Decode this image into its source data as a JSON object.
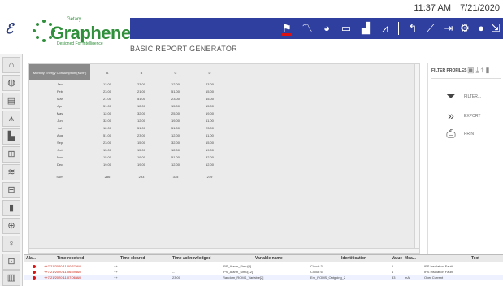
{
  "header": {
    "time": "11:37 AM",
    "date": "7/21/2020",
    "logo_mark": "ℰ",
    "brand": "Graphene",
    "brand_trademark": "®",
    "brand_company": "Getary",
    "brand_tagline": "Designed For Intelligence"
  },
  "page_title": "BASIC REPORT GENERATOR",
  "navbar_icons": [
    "alarm-flag-icon",
    "line-chart-icon",
    "pie-chart-icon",
    "monitor-icon",
    "bar-chart-icon",
    "report-chart-icon",
    "back-arrow-icon",
    "trend-icon",
    "export-icon",
    "settings-gear-icon",
    "user-icon",
    "logout-icon",
    "info-icon"
  ],
  "sidebar_icons": [
    "home-icon",
    "globe-icon",
    "panel-icon",
    "transmission-tower-icon",
    "bar-chart-icon",
    "single-line-diagram-icon",
    "wind-icon",
    "motor-icon",
    "battery-icon",
    "zoom-icon",
    "probe-icon",
    "network-icon",
    "building-icon"
  ],
  "report": {
    "header": [
      "Monthly Energy Consumption (KWH)",
      "A",
      "B",
      "C",
      "D"
    ],
    "rows": [
      [
        "Jan",
        "12.00",
        "23.00",
        "12.00",
        "23.00"
      ],
      [
        "Feb",
        "23.00",
        "21.00",
        "51.00",
        "15.00"
      ],
      [
        "Mar",
        "21.00",
        "51.00",
        "23.00",
        "15.00"
      ],
      [
        "Apr",
        "51.00",
        "12.00",
        "15.00",
        "15.00"
      ],
      [
        "May",
        "12.00",
        "32.00",
        "25.00",
        "19.00"
      ],
      [
        "Jun",
        "32.00",
        "12.00",
        "19.00",
        "11.00"
      ],
      [
        "Jul",
        "12.00",
        "51.00",
        "51.00",
        "23.00"
      ],
      [
        "Aug",
        "51.00",
        "23.00",
        "12.00",
        "11.00"
      ],
      [
        "Sep",
        "23.00",
        "15.00",
        "32.00",
        "15.00"
      ],
      [
        "Oct",
        "15.00",
        "15.00",
        "12.00",
        "19.00"
      ],
      [
        "Nov",
        "15.00",
        "19.00",
        "51.00",
        "32.00"
      ],
      [
        "Dec",
        "19.00",
        "19.00",
        "12.00",
        "12.00"
      ]
    ],
    "sum_label": "Sum",
    "sums": [
      "286",
      "293",
      "335",
      "219"
    ]
  },
  "right_panel": {
    "filter_profiles": "FILTER PROFILES",
    "filter": "FILTER...",
    "export": "EXPORT",
    "print": "PRINT"
  },
  "alarms": {
    "columns": [
      "Ala...",
      "Time received",
      "Time cleared",
      "Time acknowledged",
      "Variable name",
      "Identification",
      "Value",
      "Mea...",
      "Text"
    ],
    "rows": [
      {
        "time": "++7/21/2020 11:00:37 AM",
        "cleared": "++",
        "ack": "--",
        "variable": "IPS_Alarm_Simu[9]",
        "ident": "Circuit 3",
        "value": "1",
        "unit": "",
        "text": "IPS Insulation Fault"
      },
      {
        "time": "++7/21/2020 11:06:39 AM",
        "cleared": "++",
        "ack": "--",
        "variable": "IPS_Alarm_Simu[12]",
        "ident": "Circuit 6",
        "value": "1",
        "unit": "",
        "text": "IPS Insulation Fault"
      },
      {
        "time": "++7/21/2020 11:07:06 AM",
        "cleared": "++",
        "ack": "23:00",
        "variable": "Random_ROMS_Variable[2]",
        "ident": "Em_ROMS_Outgoing_2",
        "value": "33",
        "unit": "mA",
        "text": "Over Current"
      }
    ]
  },
  "colors": {
    "navbar": "#2f3fa0",
    "brand_green": "#2f8f3a",
    "alarm_red": "#d11111"
  }
}
